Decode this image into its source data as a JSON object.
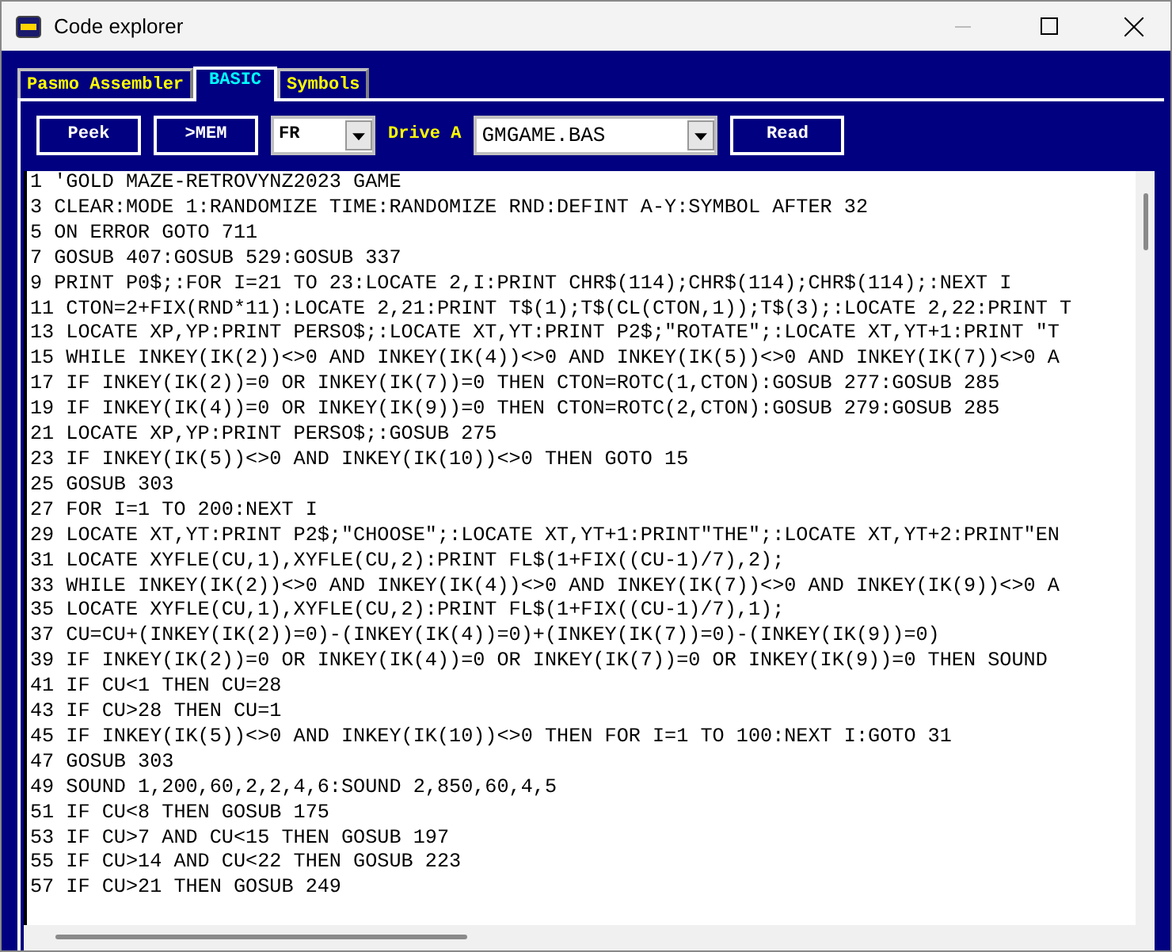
{
  "window": {
    "title": "Code explorer"
  },
  "tabs": [
    {
      "label": "Pasmo Assembler",
      "selected": false
    },
    {
      "label": "BASIC",
      "selected": true
    },
    {
      "label": "Symbols",
      "selected": false
    }
  ],
  "toolbar": {
    "buttons": [
      "Peek",
      ">MEM"
    ],
    "language": {
      "value": "FR"
    },
    "drive_label": "Drive A",
    "file": {
      "value": "GMGAME.BAS"
    },
    "read_button": "Read"
  },
  "code_lines": [
    "1 'GOLD MAZE-RETROVYNZ2023 GAME",
    "3 CLEAR:MODE 1:RANDOMIZE TIME:RANDOMIZE RND:DEFINT A-Y:SYMBOL AFTER 32",
    "5 ON ERROR GOTO 711",
    "7 GOSUB 407:GOSUB 529:GOSUB 337",
    "9 PRINT P0$;:FOR I=21 TO 23:LOCATE 2,I:PRINT CHR$(114);CHR$(114);CHR$(114);:NEXT I",
    "11 CTON=2+FIX(RND*11):LOCATE 2,21:PRINT T$(1);T$(CL(CTON,1));T$(3);:LOCATE 2,22:PRINT T",
    "13 LOCATE XP,YP:PRINT PERSO$;:LOCATE XT,YT:PRINT P2$;\"ROTATE\";:LOCATE XT,YT+1:PRINT \"T",
    "15 WHILE INKEY(IK(2))<>0 AND INKEY(IK(4))<>0 AND INKEY(IK(5))<>0 AND INKEY(IK(7))<>0 A",
    "17 IF INKEY(IK(2))=0 OR INKEY(IK(7))=0 THEN CTON=ROTC(1,CTON):GOSUB 277:GOSUB 285",
    "19 IF INKEY(IK(4))=0 OR INKEY(IK(9))=0 THEN CTON=ROTC(2,CTON):GOSUB 279:GOSUB 285",
    "21 LOCATE XP,YP:PRINT PERSO$;:GOSUB 275",
    "23 IF INKEY(IK(5))<>0 AND INKEY(IK(10))<>0 THEN GOTO 15",
    "25 GOSUB 303",
    "27 FOR I=1 TO 200:NEXT I",
    "29 LOCATE XT,YT:PRINT P2$;\"CHOOSE\";:LOCATE XT,YT+1:PRINT\"THE\";:LOCATE XT,YT+2:PRINT\"EN",
    "31 LOCATE XYFLE(CU,1),XYFLE(CU,2):PRINT FL$(1+FIX((CU-1)/7),2);",
    "33 WHILE INKEY(IK(2))<>0 AND INKEY(IK(4))<>0 AND INKEY(IK(7))<>0 AND INKEY(IK(9))<>0 A",
    "35 LOCATE XYFLE(CU,1),XYFLE(CU,2):PRINT FL$(1+FIX((CU-1)/7),1);",
    "37 CU=CU+(INKEY(IK(2))=0)-(INKEY(IK(4))=0)+(INKEY(IK(7))=0)-(INKEY(IK(9))=0)",
    "39 IF INKEY(IK(2))=0 OR INKEY(IK(4))=0 OR INKEY(IK(7))=0 OR INKEY(IK(9))=0 THEN SOUND",
    "41 IF CU<1 THEN CU=28",
    "43 IF CU>28 THEN CU=1",
    "45 IF INKEY(IK(5))<>0 AND INKEY(IK(10))<>0 THEN FOR I=1 TO 100:NEXT I:GOTO 31",
    "47 GOSUB 303",
    "49 SOUND 1,200,60,2,2,4,6:SOUND 2,850,60,4,5",
    "51 IF CU<8 THEN GOSUB 175",
    "53 IF CU>7 AND CU<15 THEN GOSUB 197",
    "55 IF CU>14 AND CU<22 THEN GOSUB 223",
    "57 IF CU>21 THEN GOSUB 249"
  ]
}
